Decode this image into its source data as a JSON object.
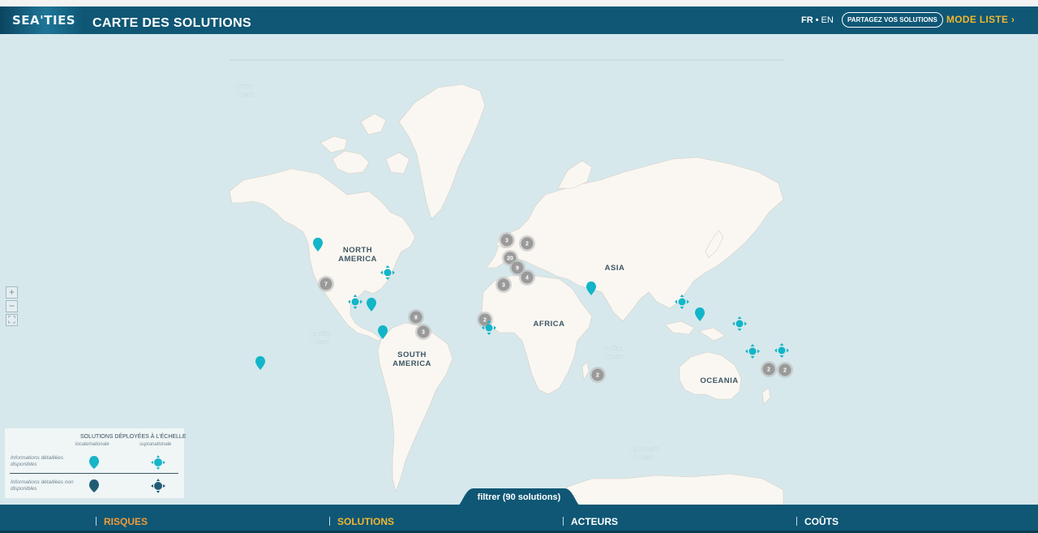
{
  "header": {
    "logo": "SEA'TIES",
    "title": "CARTE DES SOLUTIONS",
    "lang_active": "FR",
    "lang_sep": "•",
    "lang_other": "EN",
    "share_button": "PARTAGEZ VOS SOLUTIONS",
    "mode_button": "MODE LISTE",
    "mode_chevron": "›"
  },
  "map": {
    "ocean_labels": {
      "arctic_1": "Arctic",
      "arctic_2": "Ocean",
      "pacific_1": "Pacific",
      "pacific_2": "Ocean",
      "indian_1": "Indian",
      "indian_2": "Ocean",
      "southern_1": "Southern",
      "southern_2": "Ocean"
    },
    "continent_labels": {
      "na_1": "NORTH",
      "na_2": "AMERICA",
      "sa_1": "SOUTH",
      "sa_2": "AMERICA",
      "africa": "AFRICA",
      "asia": "ASIA",
      "oceania": "OCEANIA"
    },
    "clusters": [
      {
        "id": "c1",
        "count": "3"
      },
      {
        "id": "c2",
        "count": "2"
      },
      {
        "id": "c3",
        "count": "20"
      },
      {
        "id": "c4",
        "count": "9"
      },
      {
        "id": "c5",
        "count": "4"
      },
      {
        "id": "c6",
        "count": "3"
      },
      {
        "id": "c7",
        "count": "7"
      },
      {
        "id": "c8",
        "count": "8"
      },
      {
        "id": "c9",
        "count": "3"
      },
      {
        "id": "c10",
        "count": "2"
      },
      {
        "id": "c11",
        "count": "2"
      },
      {
        "id": "c12",
        "count": "2"
      },
      {
        "id": "c13",
        "count": "2"
      }
    ],
    "zoom_in": "+",
    "zoom_out": "−",
    "fullscreen": "⛶"
  },
  "legend": {
    "title": "SOLUTIONS DÉPLOYÉES À L'ÉCHELLE",
    "col_local": "locale/nationale",
    "col_supra": "supranationale",
    "row1": "Informations détaillées disponibles",
    "row2": "Informations détaillées non disponibles"
  },
  "footer": {
    "filter": "filtrer (90 solutions)",
    "nav": [
      {
        "label": "RISQUES",
        "color": "#f29a3a"
      },
      {
        "label": "SOLUTIONS",
        "color": "#f2b631"
      },
      {
        "label": "ACTEURS",
        "color": "#ffffff"
      },
      {
        "label": "COÛTS",
        "color": "#ffffff"
      }
    ]
  },
  "colors": {
    "header": "#0f5775",
    "ocean": "#d6e8ec",
    "land": "#faf7f2",
    "marker_teal": "#13b5c8",
    "marker_dark": "#1d5b73",
    "cluster": "#9a9a9a",
    "accent": "#f2b631"
  }
}
